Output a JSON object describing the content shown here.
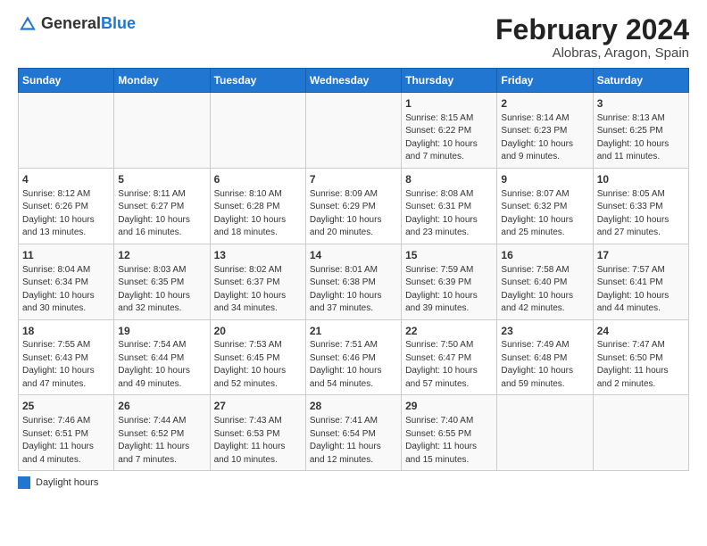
{
  "header": {
    "logo_general": "General",
    "logo_blue": "Blue",
    "main_title": "February 2024",
    "subtitle": "Alobras, Aragon, Spain"
  },
  "days_of_week": [
    "Sunday",
    "Monday",
    "Tuesday",
    "Wednesday",
    "Thursday",
    "Friday",
    "Saturday"
  ],
  "weeks": [
    [
      {
        "day": "",
        "info": ""
      },
      {
        "day": "",
        "info": ""
      },
      {
        "day": "",
        "info": ""
      },
      {
        "day": "",
        "info": ""
      },
      {
        "day": "1",
        "info": "Sunrise: 8:15 AM\nSunset: 6:22 PM\nDaylight: 10 hours\nand 7 minutes."
      },
      {
        "day": "2",
        "info": "Sunrise: 8:14 AM\nSunset: 6:23 PM\nDaylight: 10 hours\nand 9 minutes."
      },
      {
        "day": "3",
        "info": "Sunrise: 8:13 AM\nSunset: 6:25 PM\nDaylight: 10 hours\nand 11 minutes."
      }
    ],
    [
      {
        "day": "4",
        "info": "Sunrise: 8:12 AM\nSunset: 6:26 PM\nDaylight: 10 hours\nand 13 minutes."
      },
      {
        "day": "5",
        "info": "Sunrise: 8:11 AM\nSunset: 6:27 PM\nDaylight: 10 hours\nand 16 minutes."
      },
      {
        "day": "6",
        "info": "Sunrise: 8:10 AM\nSunset: 6:28 PM\nDaylight: 10 hours\nand 18 minutes."
      },
      {
        "day": "7",
        "info": "Sunrise: 8:09 AM\nSunset: 6:29 PM\nDaylight: 10 hours\nand 20 minutes."
      },
      {
        "day": "8",
        "info": "Sunrise: 8:08 AM\nSunset: 6:31 PM\nDaylight: 10 hours\nand 23 minutes."
      },
      {
        "day": "9",
        "info": "Sunrise: 8:07 AM\nSunset: 6:32 PM\nDaylight: 10 hours\nand 25 minutes."
      },
      {
        "day": "10",
        "info": "Sunrise: 8:05 AM\nSunset: 6:33 PM\nDaylight: 10 hours\nand 27 minutes."
      }
    ],
    [
      {
        "day": "11",
        "info": "Sunrise: 8:04 AM\nSunset: 6:34 PM\nDaylight: 10 hours\nand 30 minutes."
      },
      {
        "day": "12",
        "info": "Sunrise: 8:03 AM\nSunset: 6:35 PM\nDaylight: 10 hours\nand 32 minutes."
      },
      {
        "day": "13",
        "info": "Sunrise: 8:02 AM\nSunset: 6:37 PM\nDaylight: 10 hours\nand 34 minutes."
      },
      {
        "day": "14",
        "info": "Sunrise: 8:01 AM\nSunset: 6:38 PM\nDaylight: 10 hours\nand 37 minutes."
      },
      {
        "day": "15",
        "info": "Sunrise: 7:59 AM\nSunset: 6:39 PM\nDaylight: 10 hours\nand 39 minutes."
      },
      {
        "day": "16",
        "info": "Sunrise: 7:58 AM\nSunset: 6:40 PM\nDaylight: 10 hours\nand 42 minutes."
      },
      {
        "day": "17",
        "info": "Sunrise: 7:57 AM\nSunset: 6:41 PM\nDaylight: 10 hours\nand 44 minutes."
      }
    ],
    [
      {
        "day": "18",
        "info": "Sunrise: 7:55 AM\nSunset: 6:43 PM\nDaylight: 10 hours\nand 47 minutes."
      },
      {
        "day": "19",
        "info": "Sunrise: 7:54 AM\nSunset: 6:44 PM\nDaylight: 10 hours\nand 49 minutes."
      },
      {
        "day": "20",
        "info": "Sunrise: 7:53 AM\nSunset: 6:45 PM\nDaylight: 10 hours\nand 52 minutes."
      },
      {
        "day": "21",
        "info": "Sunrise: 7:51 AM\nSunset: 6:46 PM\nDaylight: 10 hours\nand 54 minutes."
      },
      {
        "day": "22",
        "info": "Sunrise: 7:50 AM\nSunset: 6:47 PM\nDaylight: 10 hours\nand 57 minutes."
      },
      {
        "day": "23",
        "info": "Sunrise: 7:49 AM\nSunset: 6:48 PM\nDaylight: 10 hours\nand 59 minutes."
      },
      {
        "day": "24",
        "info": "Sunrise: 7:47 AM\nSunset: 6:50 PM\nDaylight: 11 hours\nand 2 minutes."
      }
    ],
    [
      {
        "day": "25",
        "info": "Sunrise: 7:46 AM\nSunset: 6:51 PM\nDaylight: 11 hours\nand 4 minutes."
      },
      {
        "day": "26",
        "info": "Sunrise: 7:44 AM\nSunset: 6:52 PM\nDaylight: 11 hours\nand 7 minutes."
      },
      {
        "day": "27",
        "info": "Sunrise: 7:43 AM\nSunset: 6:53 PM\nDaylight: 11 hours\nand 10 minutes."
      },
      {
        "day": "28",
        "info": "Sunrise: 7:41 AM\nSunset: 6:54 PM\nDaylight: 11 hours\nand 12 minutes."
      },
      {
        "day": "29",
        "info": "Sunrise: 7:40 AM\nSunset: 6:55 PM\nDaylight: 11 hours\nand 15 minutes."
      },
      {
        "day": "",
        "info": ""
      },
      {
        "day": "",
        "info": ""
      }
    ]
  ],
  "footer": {
    "daylight_label": "Daylight hours"
  }
}
